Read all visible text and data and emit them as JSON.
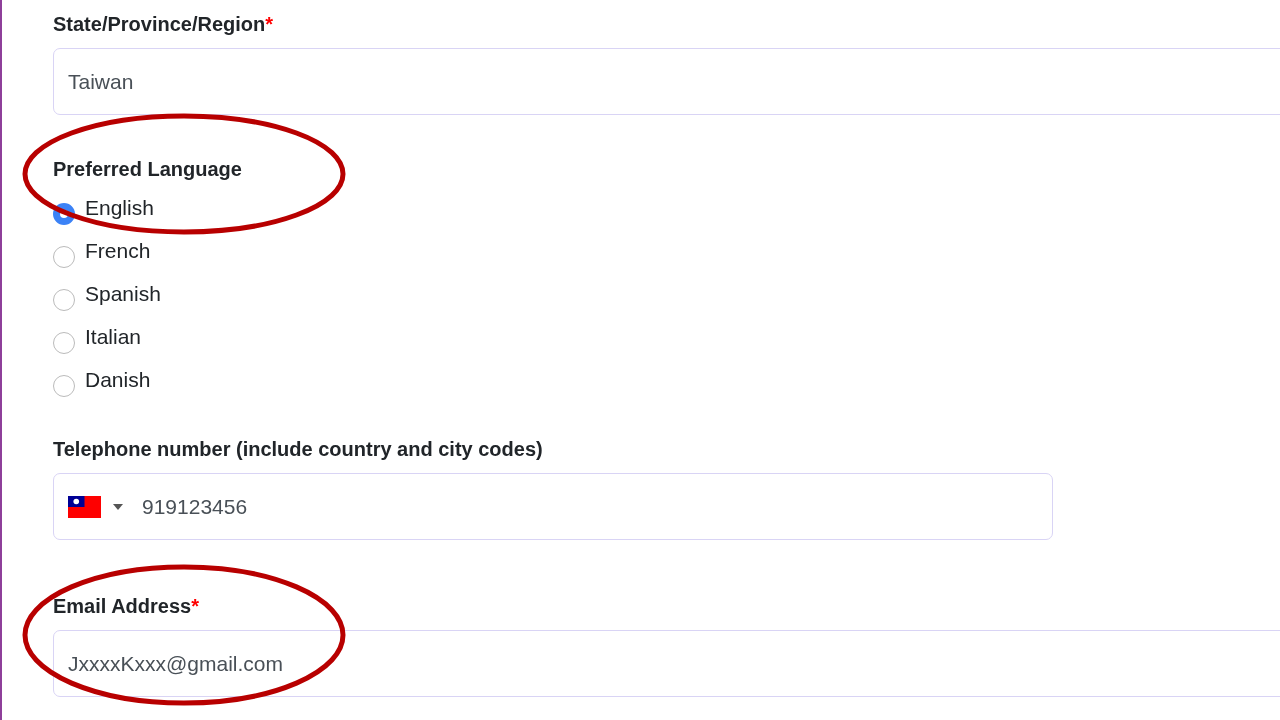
{
  "state_field": {
    "label": "State/Province/Region",
    "required_mark": "*",
    "value": "Taiwan"
  },
  "preferred_language": {
    "label": "Preferred Language",
    "circled": true,
    "options": [
      {
        "label": "English",
        "selected": true
      },
      {
        "label": "French",
        "selected": false
      },
      {
        "label": "Spanish",
        "selected": false
      },
      {
        "label": "Italian",
        "selected": false
      },
      {
        "label": "Danish",
        "selected": false
      }
    ]
  },
  "telephone_field": {
    "label": "Telephone number (include country and city codes)",
    "value": "919123456"
  },
  "email_field": {
    "label": "Email Address",
    "required_mark": "*",
    "value": "JxxxxKxxx@gmail.com",
    "circled": true
  }
}
